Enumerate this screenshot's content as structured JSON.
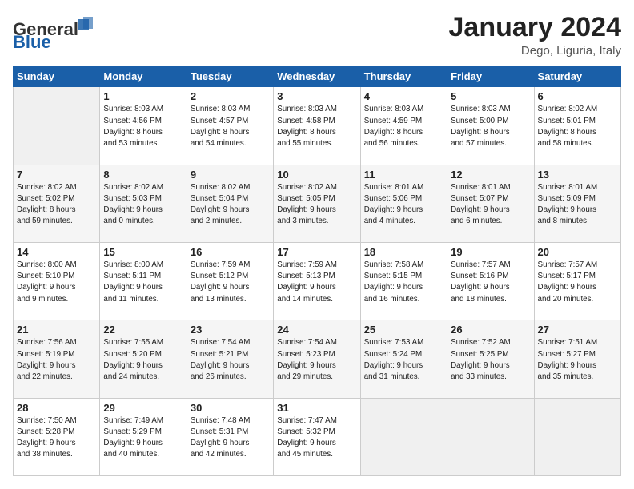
{
  "header": {
    "logo_general": "General",
    "logo_blue": "Blue",
    "month_title": "January 2024",
    "location": "Dego, Liguria, Italy"
  },
  "weekdays": [
    "Sunday",
    "Monday",
    "Tuesday",
    "Wednesday",
    "Thursday",
    "Friday",
    "Saturday"
  ],
  "weeks": [
    [
      {
        "day": "",
        "info": ""
      },
      {
        "day": "1",
        "info": "Sunrise: 8:03 AM\nSunset: 4:56 PM\nDaylight: 8 hours\nand 53 minutes."
      },
      {
        "day": "2",
        "info": "Sunrise: 8:03 AM\nSunset: 4:57 PM\nDaylight: 8 hours\nand 54 minutes."
      },
      {
        "day": "3",
        "info": "Sunrise: 8:03 AM\nSunset: 4:58 PM\nDaylight: 8 hours\nand 55 minutes."
      },
      {
        "day": "4",
        "info": "Sunrise: 8:03 AM\nSunset: 4:59 PM\nDaylight: 8 hours\nand 56 minutes."
      },
      {
        "day": "5",
        "info": "Sunrise: 8:03 AM\nSunset: 5:00 PM\nDaylight: 8 hours\nand 57 minutes."
      },
      {
        "day": "6",
        "info": "Sunrise: 8:02 AM\nSunset: 5:01 PM\nDaylight: 8 hours\nand 58 minutes."
      }
    ],
    [
      {
        "day": "7",
        "info": "Sunrise: 8:02 AM\nSunset: 5:02 PM\nDaylight: 8 hours\nand 59 minutes."
      },
      {
        "day": "8",
        "info": "Sunrise: 8:02 AM\nSunset: 5:03 PM\nDaylight: 9 hours\nand 0 minutes."
      },
      {
        "day": "9",
        "info": "Sunrise: 8:02 AM\nSunset: 5:04 PM\nDaylight: 9 hours\nand 2 minutes."
      },
      {
        "day": "10",
        "info": "Sunrise: 8:02 AM\nSunset: 5:05 PM\nDaylight: 9 hours\nand 3 minutes."
      },
      {
        "day": "11",
        "info": "Sunrise: 8:01 AM\nSunset: 5:06 PM\nDaylight: 9 hours\nand 4 minutes."
      },
      {
        "day": "12",
        "info": "Sunrise: 8:01 AM\nSunset: 5:07 PM\nDaylight: 9 hours\nand 6 minutes."
      },
      {
        "day": "13",
        "info": "Sunrise: 8:01 AM\nSunset: 5:09 PM\nDaylight: 9 hours\nand 8 minutes."
      }
    ],
    [
      {
        "day": "14",
        "info": "Sunrise: 8:00 AM\nSunset: 5:10 PM\nDaylight: 9 hours\nand 9 minutes."
      },
      {
        "day": "15",
        "info": "Sunrise: 8:00 AM\nSunset: 5:11 PM\nDaylight: 9 hours\nand 11 minutes."
      },
      {
        "day": "16",
        "info": "Sunrise: 7:59 AM\nSunset: 5:12 PM\nDaylight: 9 hours\nand 13 minutes."
      },
      {
        "day": "17",
        "info": "Sunrise: 7:59 AM\nSunset: 5:13 PM\nDaylight: 9 hours\nand 14 minutes."
      },
      {
        "day": "18",
        "info": "Sunrise: 7:58 AM\nSunset: 5:15 PM\nDaylight: 9 hours\nand 16 minutes."
      },
      {
        "day": "19",
        "info": "Sunrise: 7:57 AM\nSunset: 5:16 PM\nDaylight: 9 hours\nand 18 minutes."
      },
      {
        "day": "20",
        "info": "Sunrise: 7:57 AM\nSunset: 5:17 PM\nDaylight: 9 hours\nand 20 minutes."
      }
    ],
    [
      {
        "day": "21",
        "info": "Sunrise: 7:56 AM\nSunset: 5:19 PM\nDaylight: 9 hours\nand 22 minutes."
      },
      {
        "day": "22",
        "info": "Sunrise: 7:55 AM\nSunset: 5:20 PM\nDaylight: 9 hours\nand 24 minutes."
      },
      {
        "day": "23",
        "info": "Sunrise: 7:54 AM\nSunset: 5:21 PM\nDaylight: 9 hours\nand 26 minutes."
      },
      {
        "day": "24",
        "info": "Sunrise: 7:54 AM\nSunset: 5:23 PM\nDaylight: 9 hours\nand 29 minutes."
      },
      {
        "day": "25",
        "info": "Sunrise: 7:53 AM\nSunset: 5:24 PM\nDaylight: 9 hours\nand 31 minutes."
      },
      {
        "day": "26",
        "info": "Sunrise: 7:52 AM\nSunset: 5:25 PM\nDaylight: 9 hours\nand 33 minutes."
      },
      {
        "day": "27",
        "info": "Sunrise: 7:51 AM\nSunset: 5:27 PM\nDaylight: 9 hours\nand 35 minutes."
      }
    ],
    [
      {
        "day": "28",
        "info": "Sunrise: 7:50 AM\nSunset: 5:28 PM\nDaylight: 9 hours\nand 38 minutes."
      },
      {
        "day": "29",
        "info": "Sunrise: 7:49 AM\nSunset: 5:29 PM\nDaylight: 9 hours\nand 40 minutes."
      },
      {
        "day": "30",
        "info": "Sunrise: 7:48 AM\nSunset: 5:31 PM\nDaylight: 9 hours\nand 42 minutes."
      },
      {
        "day": "31",
        "info": "Sunrise: 7:47 AM\nSunset: 5:32 PM\nDaylight: 9 hours\nand 45 minutes."
      },
      {
        "day": "",
        "info": ""
      },
      {
        "day": "",
        "info": ""
      },
      {
        "day": "",
        "info": ""
      }
    ]
  ]
}
